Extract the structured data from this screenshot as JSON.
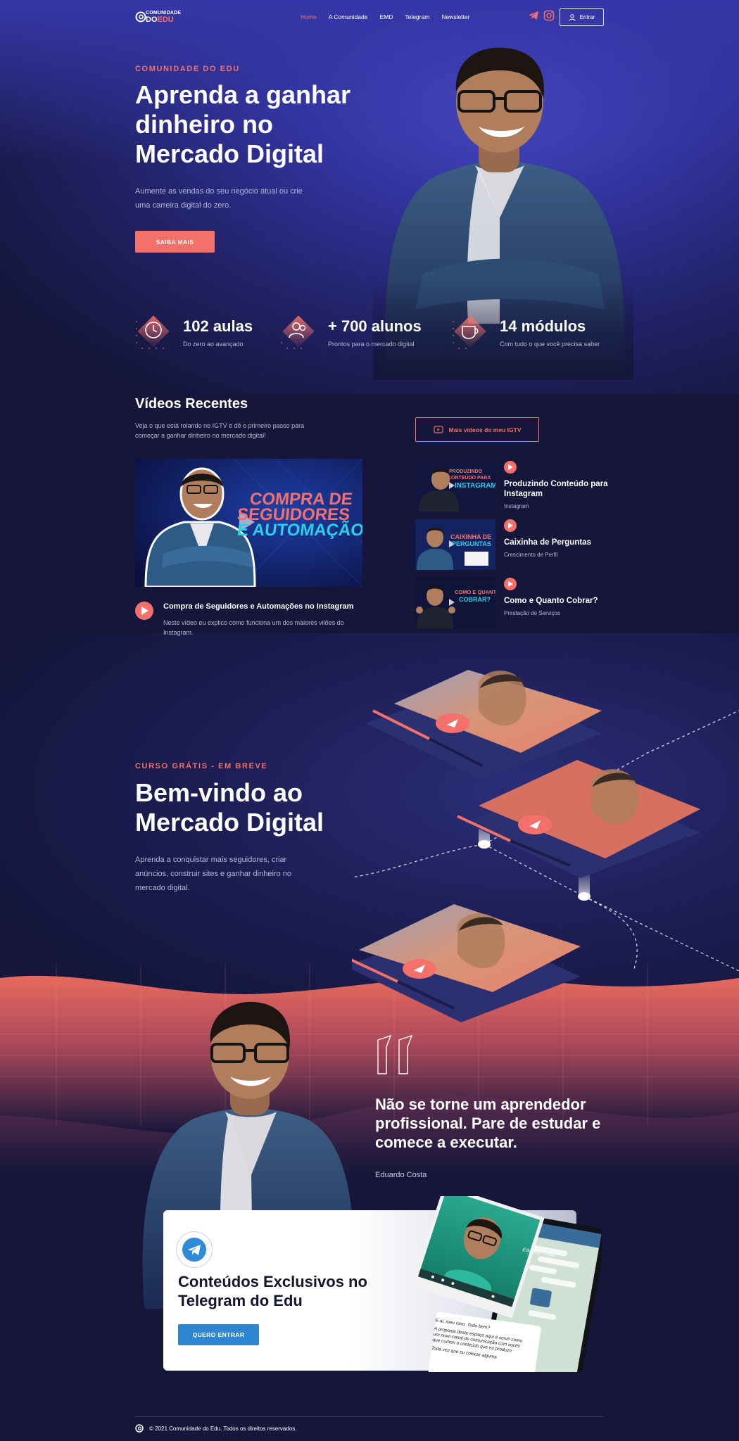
{
  "header": {
    "logo_top": "COMUNIDADE",
    "logo_do": "DO",
    "logo_edu": "EDU",
    "nav": [
      "Home",
      "A Comunidade",
      "EMD",
      "Telegram",
      "Newsletter"
    ],
    "active_nav": "Home",
    "login_label": "Entrar"
  },
  "hero": {
    "eyebrow": "COMUNIDADE DO EDU",
    "title": "Aprenda a ganhar dinheiro no Mercado Digital",
    "subtitle": "Aumente as vendas do seu negócio atual ou crie uma carreira digital do zero.",
    "cta": "SAIBA MAIS"
  },
  "stats": [
    {
      "value": "102 aulas",
      "label": "Do zero ao avançado",
      "icon": "clock-icon"
    },
    {
      "value": "+ 700 alunos",
      "label": "Prontos para o mercado digital",
      "icon": "users-icon"
    },
    {
      "value": "14 módulos",
      "label": "Com tudo o que você precisa saber",
      "icon": "cup-icon"
    }
  ],
  "videos": {
    "title": "Vídeos Recentes",
    "subtitle": "Veja o que está rolando no IGTV e dê o primeiro passo para começar a ganhar dinheiro no mercado digital!",
    "more_button": "Mais vídeos do meu IGTV",
    "featured": {
      "thumb_text_1": "COMPRA DE",
      "thumb_text_2": "SEGUIDORES",
      "thumb_text_3": "E AUTOMAÇÃO",
      "title": "Compra de Seguidores e Automações no Instagram",
      "description": "Neste vídeo eu explico como funciona um dos maiores vilões do Instagram."
    },
    "list": [
      {
        "thumb_text_1": "PRODUZINDO",
        "thumb_text_2": "CONTEÚDO PARA",
        "thumb_text_3": "INSTAGRAM",
        "title": "Produzindo Conteúdo para Instagram",
        "category": "Instagram"
      },
      {
        "thumb_text_1": "CAIXINHA DE",
        "thumb_text_2": "PERGUNTAS",
        "thumb_text_3": "",
        "title": "Caixinha de Perguntas",
        "category": "Crescimento de Perfil"
      },
      {
        "thumb_text_1": "COMO E QUANTO",
        "thumb_text_2": "COBRAR?",
        "thumb_text_3": "",
        "title": "Como e Quanto Cobrar?",
        "category": "Prestação de Serviços"
      }
    ]
  },
  "course": {
    "eyebrow": "CURSO GRÁTIS - EM BREVE",
    "title": "Bem-vindo ao Mercado Digital",
    "subtitle": "Aprenda a conquistar mais seguidores, criar anúncios, construir sites e ganhar dinheiro no mercado digital."
  },
  "quote": {
    "text": "Não se torne um aprendedor profissional. Pare de estudar e comece a executar.",
    "author": "Eduardo Costa"
  },
  "telegram": {
    "title": "Conteúdos Exclusivos no Telegram do Edu",
    "cta": "QUERO ENTRAR",
    "mock_contact": "Eduardo Costa",
    "mock_msg_1": "E aí, meu caro. Tudo bem?",
    "mock_msg_2": "A proposta deste espaço aqui é servir como um novo canal de comunicação com vocês que curtem o conteúdo que eu produzo",
    "mock_msg_3": "Toda vez que eu colocar alguma"
  },
  "footer": {
    "text": "© 2021 Comunidade do Edu. Todos os direitos reservados."
  },
  "colors": {
    "accent": "#f4706a",
    "background": "#15163a",
    "hero_blue": "#3537a8",
    "telegram_blue": "#2f86d0"
  }
}
